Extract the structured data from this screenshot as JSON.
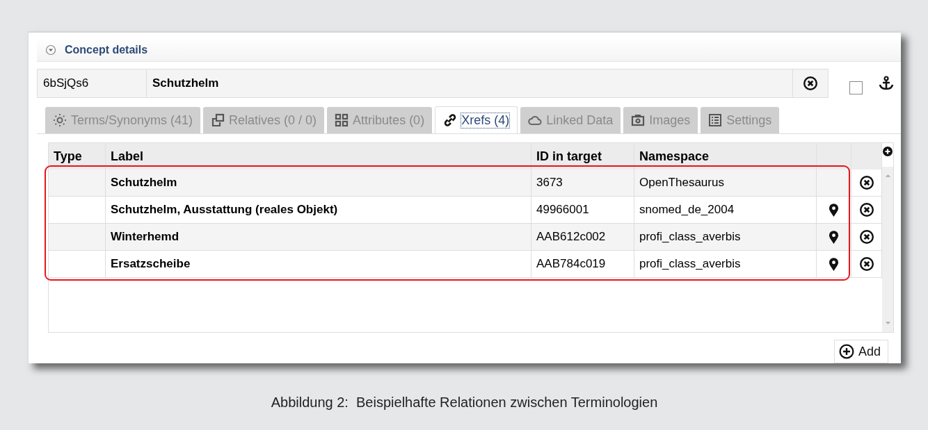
{
  "panel": {
    "title": "Concept details",
    "expanded": true
  },
  "concept": {
    "id": "6bSjQs6",
    "name": "Schutzhelm",
    "anchored": false
  },
  "tabs": [
    {
      "label": "Terms/Synonyms (41)",
      "selected": false
    },
    {
      "label": "Relatives (0 / 0)",
      "selected": false
    },
    {
      "label": "Attributes (0)",
      "selected": false
    },
    {
      "label": "Xrefs (4)",
      "selected": true
    },
    {
      "label": "Linked Data",
      "selected": false
    },
    {
      "label": "Images",
      "selected": false
    },
    {
      "label": "Settings",
      "selected": false
    }
  ],
  "table": {
    "columns": [
      "Type",
      "Label",
      "ID in target",
      "Namespace"
    ],
    "rows": [
      {
        "label": "Schutzhelm",
        "id": "3673",
        "namespace": "OpenThesaurus",
        "located": false
      },
      {
        "label": "Schutzhelm, Ausstattung (reales Objekt)",
        "id": "49966001",
        "namespace": "snomed_de_2004",
        "located": true
      },
      {
        "label": "Winterhemd",
        "id": "AAB612c002",
        "namespace": "profi_class_averbis",
        "located": true
      },
      {
        "label": "Ersatzscheibe",
        "id": "AAB784c019",
        "namespace": "profi_class_averbis",
        "located": true
      }
    ]
  },
  "add_button": "Add",
  "caption": "Abbildung 2:  Beispielhafte Relationen zwischen Terminologien"
}
